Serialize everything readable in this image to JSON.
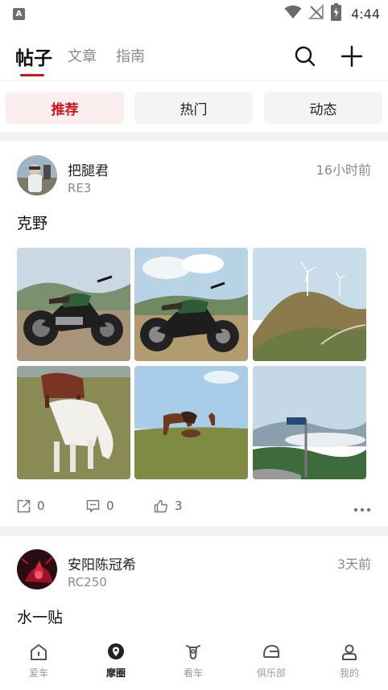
{
  "status_bar": {
    "left_badge": "A",
    "time": "4:44",
    "icons": [
      "wifi-icon",
      "no-signal-icon",
      "battery-charging-icon"
    ]
  },
  "header": {
    "tabs": [
      {
        "label": "帖子",
        "active": true
      },
      {
        "label": "文章",
        "active": false
      },
      {
        "label": "指南",
        "active": false
      }
    ],
    "accent_color": "#d8151e",
    "actions": [
      "search-icon",
      "plus-icon"
    ]
  },
  "filters": [
    {
      "label": "推荐",
      "active": true
    },
    {
      "label": "热门",
      "active": false
    },
    {
      "label": "动态",
      "active": false
    }
  ],
  "posts": [
    {
      "author": "把腿君",
      "model": "RE3",
      "time": "16小时前",
      "text": "克野",
      "photos": [
        "motorcycle-photo",
        "motorcycle-photo",
        "wind-turbine-hill-photo",
        "white-horse-photo",
        "grazing-horses-photo",
        "mountain-road-sign-photo"
      ],
      "stats": {
        "share": "0",
        "comments": "0",
        "likes": "3"
      }
    },
    {
      "author": "安阳陈冠希",
      "model": "RC250",
      "time": "3天前",
      "text": "水一贴"
    }
  ],
  "bottom_nav": [
    {
      "label": "爱车",
      "icon": "home-icon",
      "active": false
    },
    {
      "label": "摩圈",
      "icon": "location-pin-icon",
      "active": true
    },
    {
      "label": "看车",
      "icon": "motorbike-front-icon",
      "active": false
    },
    {
      "label": "俱乐部",
      "icon": "helmet-icon",
      "active": false
    },
    {
      "label": "我的",
      "icon": "user-icon",
      "active": false
    }
  ]
}
